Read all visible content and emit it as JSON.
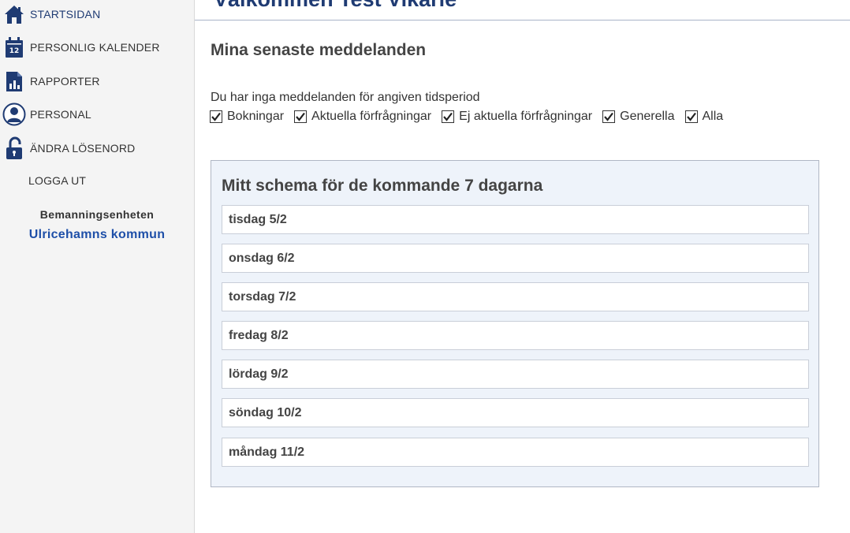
{
  "sidebar": {
    "items": [
      {
        "label": "STARTSIDAN",
        "icon": "home-icon"
      },
      {
        "label": "PERSONLIG KALENDER",
        "icon": "calendar-icon",
        "icon_text": "12"
      },
      {
        "label": "RAPPORTER",
        "icon": "report-icon"
      },
      {
        "label": "PERSONAL",
        "icon": "person-icon"
      },
      {
        "label": "ÄNDRA LÖSENORD",
        "icon": "unlock-icon"
      },
      {
        "label": "LOGGA UT"
      }
    ],
    "org_unit": "Bemanningsenheten",
    "org_name": "Ulricehamns kommun"
  },
  "header": {
    "title": "Välkommen Test Vikarie"
  },
  "messages": {
    "title": "Mina senaste meddelanden",
    "empty_text": "Du har inga meddelanden för angiven tidsperiod",
    "filters": [
      {
        "label": "Bokningar",
        "checked": true
      },
      {
        "label": "Aktuella förfrågningar",
        "checked": true
      },
      {
        "label": "Ej aktuella förfrågningar",
        "checked": true
      },
      {
        "label": "Generella",
        "checked": true
      },
      {
        "label": "Alla",
        "checked": true
      }
    ]
  },
  "schedule": {
    "title": "Mitt schema för de kommande 7 dagarna",
    "days": [
      {
        "label": "tisdag 5/2"
      },
      {
        "label": "onsdag 6/2"
      },
      {
        "label": "torsdag 7/2"
      },
      {
        "label": "fredag 8/2"
      },
      {
        "label": "lördag 9/2"
      },
      {
        "label": "söndag 10/2"
      },
      {
        "label": "måndag 11/2"
      }
    ]
  },
  "colors": {
    "accent": "#1f3b73",
    "org_link": "#1e4fa8",
    "sidebar_bg": "#f4f4f4",
    "schedule_bg": "#eef3fa"
  }
}
